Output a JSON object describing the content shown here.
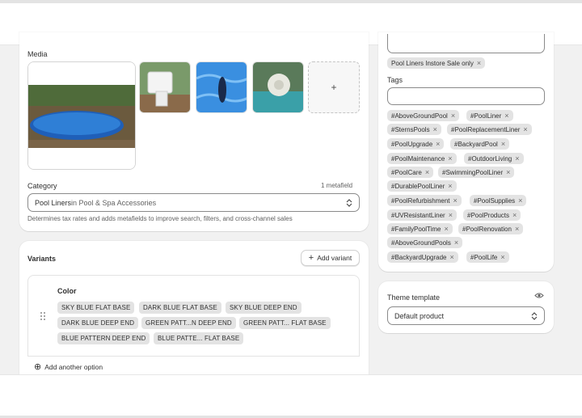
{
  "media": {
    "label": "Media",
    "add_symbol": "+"
  },
  "category": {
    "label": "Category",
    "metafield_count": "1 metafield",
    "value_main": "Pool Liners",
    "value_rest": " in Pool & Spa Accessories",
    "help": "Determines tax rates and adds metafields to improve search, filters, and cross-channel sales"
  },
  "variants": {
    "title": "Variants",
    "add_variant_label": "Add variant",
    "option_name": "Color",
    "values": [
      "SKY BLUE FLAT BASE",
      "DARK BLUE FLAT BASE",
      "SKY BLUE DEEP END",
      "DARK BLUE DEEP END",
      "GREEN PATT...N DEEP END",
      "GREEN PATT... FLAT BASE",
      "BLUE PATTERN DEEP END",
      "BLUE PATTE... FLAT BASE"
    ],
    "add_option_label": "Add another option"
  },
  "collections": {
    "selected": [
      "Pool Liners Instore Sale only"
    ]
  },
  "tags": {
    "label": "Tags",
    "items": [
      "#AboveGroundPool",
      "#PoolLiner",
      "#SternsPools",
      "#PoolReplacementLiner",
      "#PoolUpgrade",
      "#BackyardPool",
      "#PoolMaintenance",
      "#OutdoorLiving",
      "#PoolCare",
      "#SwimmingPoolLiner",
      "#DurablePoolLiner",
      "#PoolRefurbishment",
      "#PoolSupplies",
      "#UVResistantLiner",
      "#PoolProducts",
      "#FamilyPoolTime",
      "#PoolRenovation",
      "#AboveGroundPools",
      "#BackyardUpgrade",
      "#PoolLife"
    ]
  },
  "theme": {
    "label": "Theme template",
    "value": "Default product"
  },
  "icons": {
    "remove": "×",
    "plus": "+",
    "circle_plus": "⊕"
  }
}
